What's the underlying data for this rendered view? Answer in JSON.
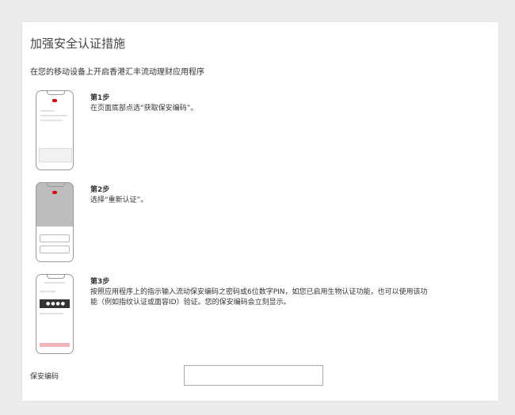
{
  "page": {
    "title": "加强安全认证措施",
    "subtitle": "在您的移动设备上开启香港汇丰流动理财应用程序"
  },
  "steps": [
    {
      "heading": "第1步",
      "text": "在页面底部点选“获取保安编码”。"
    },
    {
      "heading": "第2步",
      "text": "选择“重新认证”。"
    },
    {
      "heading": "第3步",
      "text": "按照应用程序上的指示输入流动保安编码之密码或6位数字PIN，如您已启用生物认证功能，也可以使用该功能（例如指纹认证或面容ID）验证。您的保安编码会立刻显示。"
    }
  ],
  "security_code": {
    "label": "保安编码",
    "value": "",
    "placeholder": ""
  },
  "colors": {
    "accent": "#db0011",
    "background": "#ececec",
    "card": "#ffffff"
  }
}
